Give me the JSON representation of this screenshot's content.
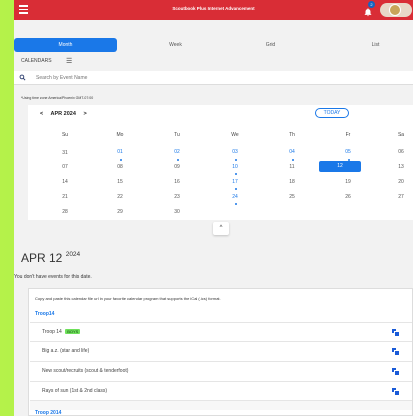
{
  "header": {
    "title": "Scoutbook Plus Internet Advancement",
    "notification_count": "2",
    "colors": {
      "topbar": "#d92d36",
      "accent": "#1a78e8"
    }
  },
  "tabs": [
    {
      "label": "Month",
      "active": true
    },
    {
      "label": "Week"
    },
    {
      "label": "Grid"
    },
    {
      "label": "List"
    }
  ],
  "calendars": {
    "header": "CALENDARS",
    "search_placeholder": "Search by Event Name",
    "timezone": "*Using time zone America/Phoenix GMT-07:00"
  },
  "calendar": {
    "month_label": "APR 2024",
    "today_label": "TODAY",
    "weekdays": [
      "Su",
      "Mo",
      "Tu",
      "We",
      "Th",
      "Fr",
      "Sa"
    ],
    "weeks": [
      [
        "31",
        "01",
        "02",
        "03",
        "04",
        "05",
        "06"
      ],
      [
        "07",
        "08",
        "09",
        "10",
        "11",
        "12",
        "13"
      ],
      [
        "14",
        "15",
        "16",
        "17",
        "18",
        "19",
        "20"
      ],
      [
        "21",
        "22",
        "23",
        "24",
        "25",
        "26",
        "27"
      ],
      [
        "28",
        "29",
        "30",
        "",
        "",
        "",
        ""
      ]
    ],
    "selected": "12"
  },
  "selected_date": {
    "label": "APR 12",
    "year": "2024",
    "no_events": "You don't have events for this date."
  },
  "ical": {
    "hint": "Copy and paste this calendar file url in your favorite calendar program that supports the iCal (.ics) format.",
    "groups": [
      {
        "title": "Troop14",
        "items": [
          {
            "name": "Troop 14",
            "tag": "BOYS"
          },
          {
            "name": "Big a.z. (star and life)"
          },
          {
            "name": "New scout/recruits (scout & tenderfoot)"
          },
          {
            "name": "Rays of sun (1st & 2nd class)"
          }
        ]
      },
      {
        "title": "Troop 2014",
        "items": []
      }
    ]
  }
}
